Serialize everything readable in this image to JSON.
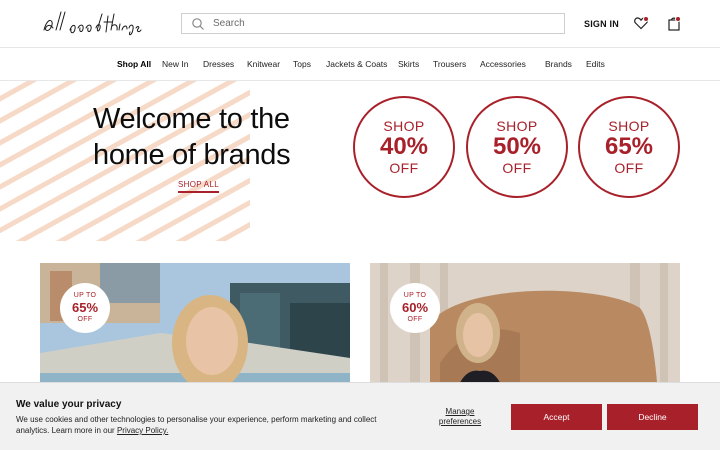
{
  "header": {
    "logo_text": "all good things",
    "search_placeholder": "Search",
    "signin_label": "SIGN IN",
    "icons": [
      "heart-icon",
      "bag-icon",
      "search-icon"
    ]
  },
  "nav": {
    "items": [
      "Shop All",
      "New In",
      "Dresses",
      "Knitwear",
      "Tops",
      "Jackets & Coats",
      "Skirts",
      "Trousers",
      "Accessories",
      "Brands",
      "Edits"
    ],
    "active": "Shop All"
  },
  "hero": {
    "title_line1": "Welcome to the",
    "title_line2": "home of brands",
    "cta": "SHOP ALL",
    "promos": [
      {
        "top": "SHOP",
        "value": "40%",
        "bottom": "OFF"
      },
      {
        "top": "SHOP",
        "value": "50%",
        "bottom": "OFF"
      },
      {
        "top": "SHOP",
        "value": "65%",
        "bottom": "OFF"
      }
    ]
  },
  "cards": [
    {
      "badge_top": "UP TO",
      "badge_value": "65%",
      "badge_bottom": "OFF"
    },
    {
      "badge_top": "UP TO",
      "badge_value": "60%",
      "badge_bottom": "OFF"
    }
  ],
  "cookie": {
    "title": "We value your privacy",
    "text": "We use cookies and other technologies to personalise your experience, perform marketing and collect analytics. Learn more in our ",
    "policy_link": "Privacy Policy.",
    "manage_label": "Manage preferences",
    "accept_label": "Accept",
    "decline_label": "Decline"
  },
  "colors": {
    "brand_red": "#a8212a",
    "stripe": "#f6d9c6",
    "banner_bg": "#f1f1f1"
  }
}
